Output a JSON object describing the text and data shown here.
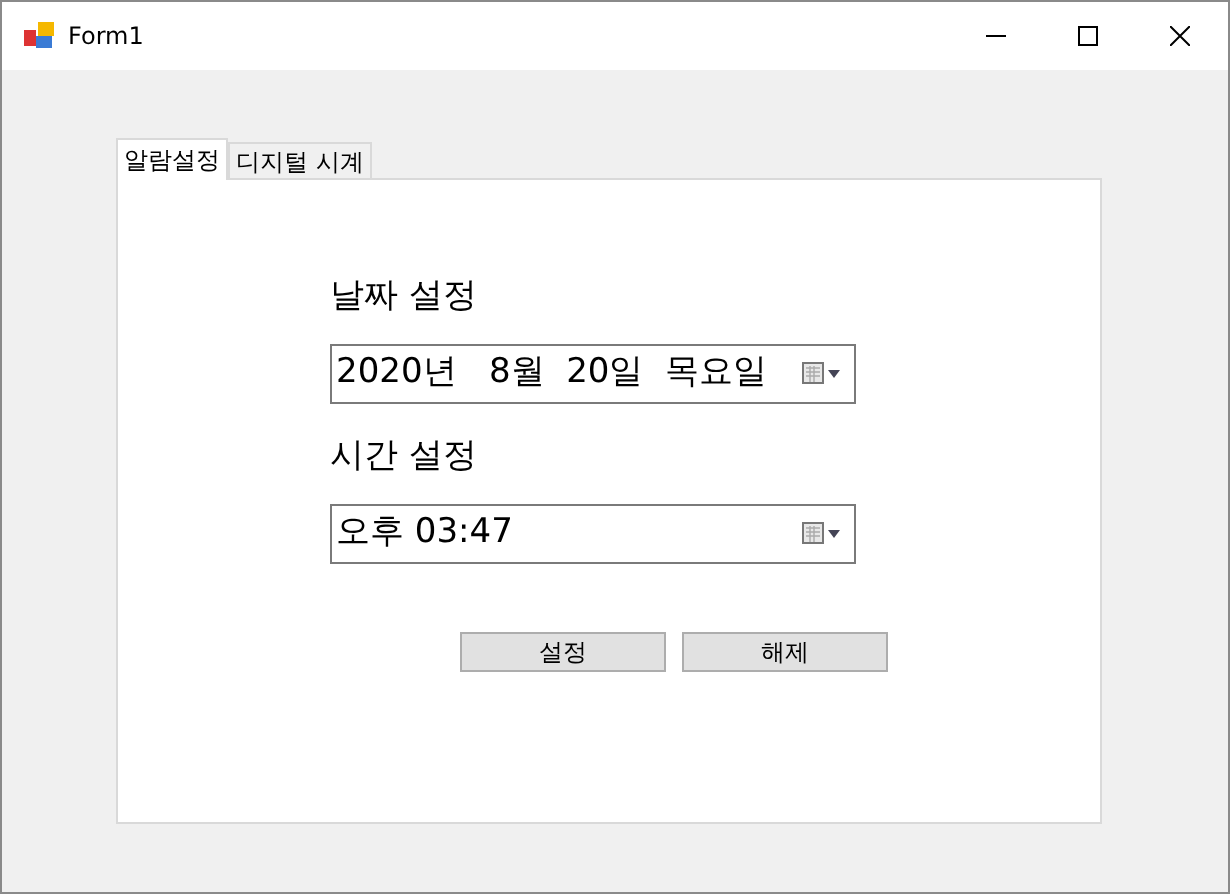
{
  "window": {
    "title": "Form1"
  },
  "tabs": [
    {
      "label": "알람설정",
      "selected": true
    },
    {
      "label": "디지털 시계",
      "selected": false
    }
  ],
  "date_setting": {
    "label": "날짜 설정",
    "value": "2020년   8월  20일  목요일"
  },
  "time_setting": {
    "label": "시간 설정",
    "value": "오후 03:47"
  },
  "buttons": [
    "설정",
    "해제"
  ]
}
